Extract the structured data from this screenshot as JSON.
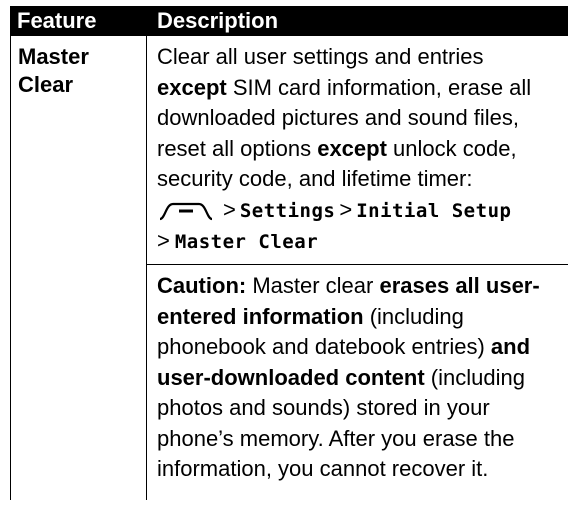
{
  "header": {
    "feature_label": "Feature",
    "description_label": "Description"
  },
  "row": {
    "feature_line1": "Master",
    "feature_line2": "Clear",
    "desc": {
      "p1_a": "Clear all user settings and entries",
      "p1_b": "except",
      "p1_c": " SIM card information, erase all downloaded pictures and sound files, reset all options ",
      "p1_d": "except",
      "p1_e": " unlock code, security code, and lifetime timer:",
      "sep": ">",
      "menu_settings": "Settings",
      "menu_initial_setup": "Initial Setup",
      "menu_master_clear": "Master Clear",
      "caution_label": "Caution:",
      "c_a": " Master clear ",
      "c_b": "erases all user-entered information",
      "c_c": " (including phonebook and datebook entries) ",
      "c_d": "and user-downloaded content",
      "c_e": " (including photos and sounds) stored in your phone’s memory. After you erase the information, you cannot recover it."
    }
  },
  "icons": {
    "menu_key": "menu-key-icon"
  }
}
